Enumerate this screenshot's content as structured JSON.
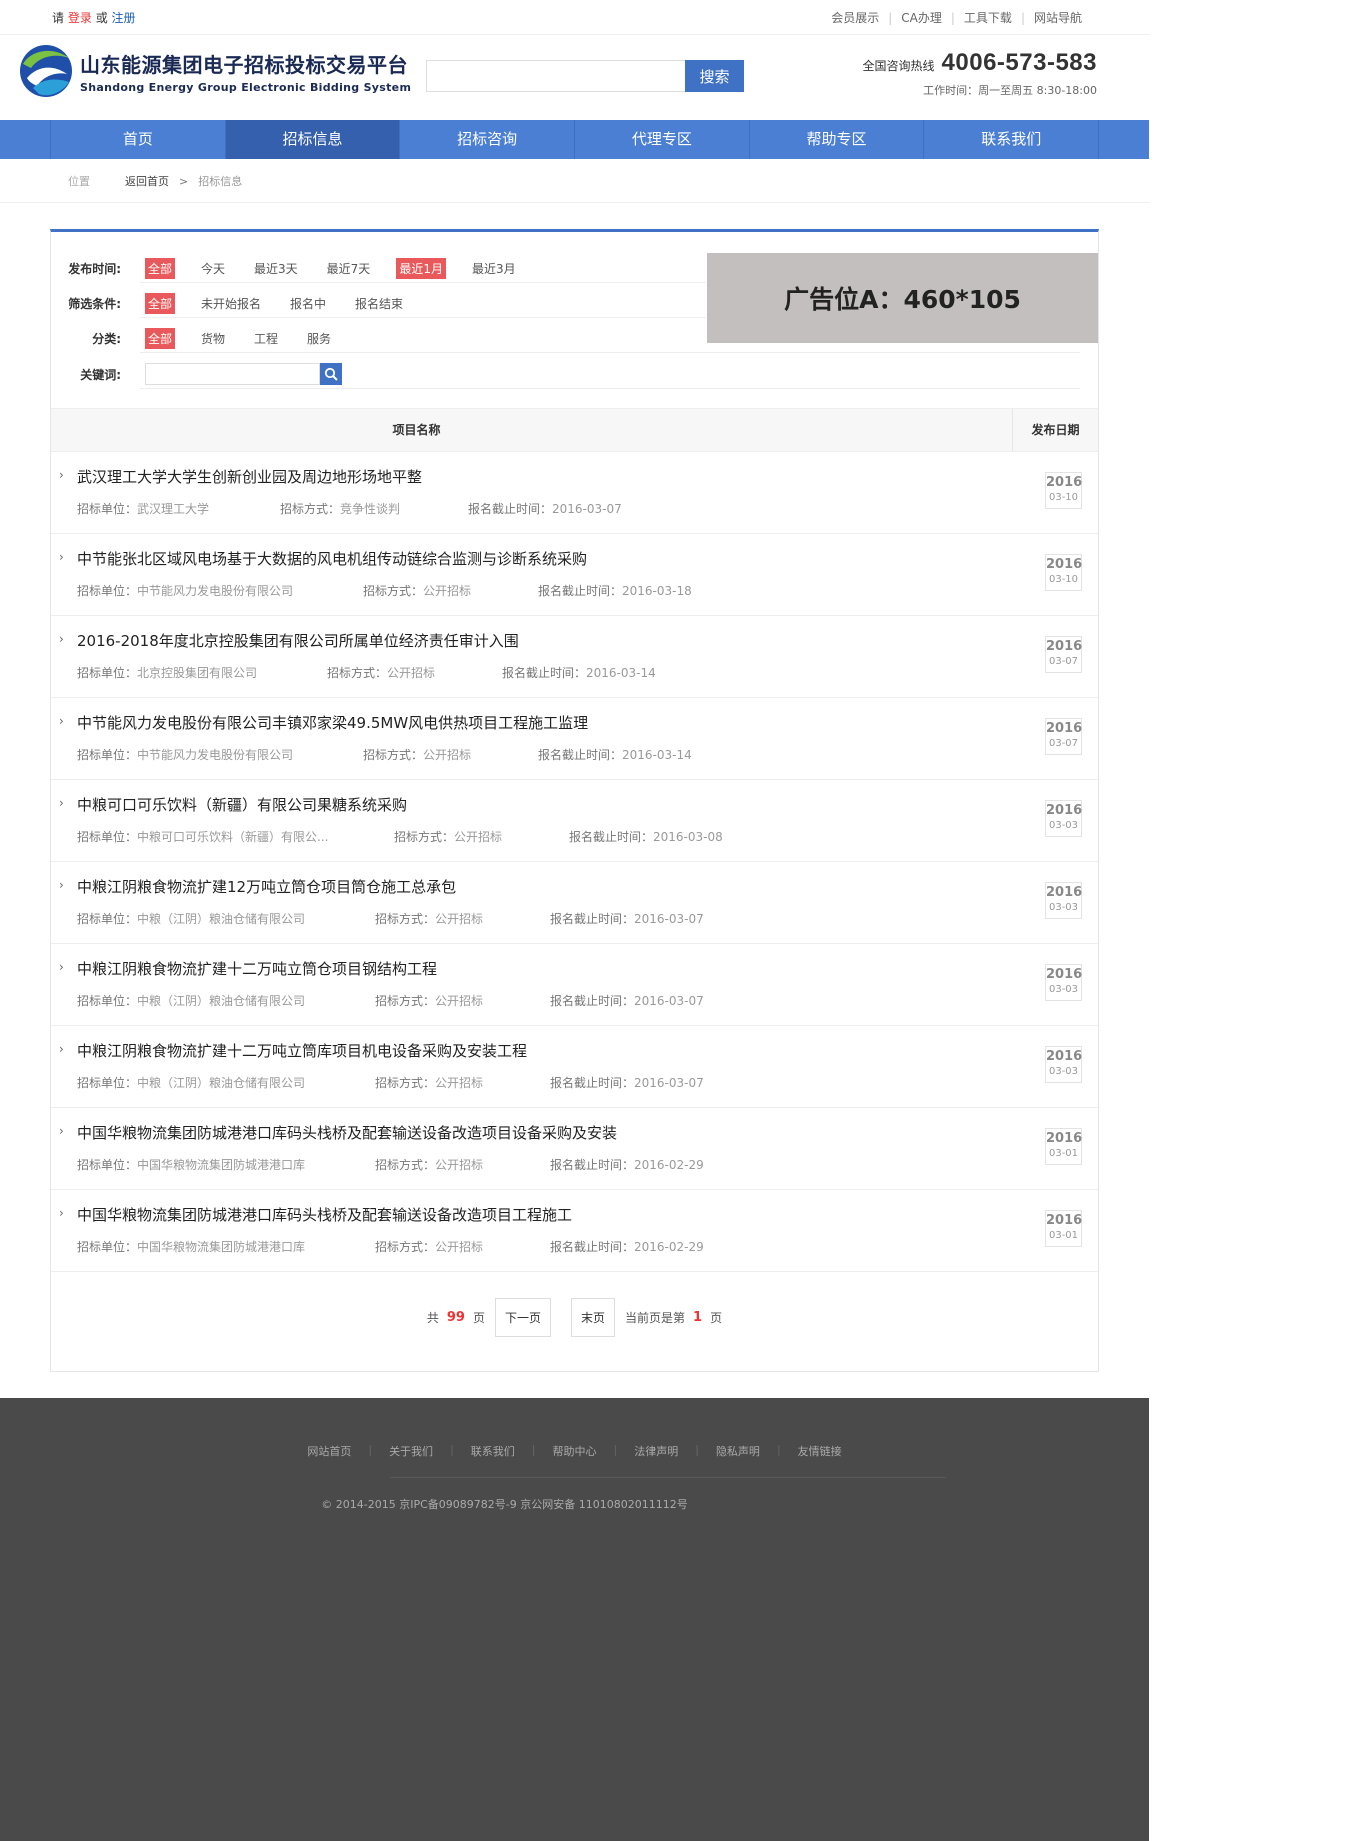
{
  "topbar": {
    "please": "请",
    "login": "登录",
    "or": "或",
    "register": "注册",
    "links": [
      "会员展示",
      "CA办理",
      "工具下载",
      "网站导航"
    ]
  },
  "header": {
    "title_cn": "山东能源集团电子招标投标交易平台",
    "title_en": "Shandong Energy Group Electronic Bidding System",
    "search_placeholder": "",
    "search_button": "搜索",
    "hotline_label": "全国咨询热线",
    "hotline_number": "4006-573-583",
    "work_time": "工作时间：周一至周五 8:30-18:00"
  },
  "nav": {
    "items": [
      "首页",
      "招标信息",
      "招标咨询",
      "代理专区",
      "帮助专区",
      "联系我们"
    ],
    "active_index": 1
  },
  "breadcrumb": {
    "position": "位置",
    "home": "返回首页",
    "arrow": ">",
    "current": "招标信息"
  },
  "filters": {
    "time": {
      "label": "发布时间:",
      "options": [
        "全部",
        "今天",
        "最近3天",
        "最近7天",
        "最近1月",
        "最近3月"
      ],
      "selected": [
        0,
        4
      ]
    },
    "condition": {
      "label": "筛选条件:",
      "options": [
        "全部",
        "未开始报名",
        "报名中",
        "报名结束"
      ],
      "selected": [
        0
      ]
    },
    "category": {
      "label": "分类:",
      "options": [
        "全部",
        "货物",
        "工程",
        "服务"
      ],
      "selected": [
        0
      ]
    },
    "keyword": {
      "label": "关键词:",
      "value": ""
    }
  },
  "ad": {
    "text": "广告位A：460*105"
  },
  "table": {
    "col_name": "项目名称",
    "col_date": "发布日期",
    "label_unit": "招标单位：",
    "label_method": "招标方式：",
    "label_deadline": "报名截止时间：",
    "rows": [
      {
        "title": "武汉理工大学大学生创新创业园及周边地形场地平整",
        "unit": "武汉理工大学",
        "method": "竞争性谈判",
        "deadline": "2016-03-07",
        "year": "2016",
        "md": "03-10"
      },
      {
        "title": "中节能张北区域风电场基于大数据的风电机组传动链综合监测与诊断系统采购",
        "unit": "中节能风力发电股份有限公司",
        "method": "公开招标",
        "deadline": "2016-03-18",
        "year": "2016",
        "md": "03-10"
      },
      {
        "title": "2016-2018年度北京控股集团有限公司所属单位经济责任审计入围",
        "unit": "北京控股集团有限公司",
        "method": "公开招标",
        "deadline": "2016-03-14",
        "year": "2016",
        "md": "03-07"
      },
      {
        "title": "中节能风力发电股份有限公司丰镇邓家梁49.5MW风电供热项目工程施工监理",
        "unit": "中节能风力发电股份有限公司",
        "method": "公开招标",
        "deadline": "2016-03-14",
        "year": "2016",
        "md": "03-07"
      },
      {
        "title": "中粮可口可乐饮料（新疆）有限公司果糖系统采购",
        "unit": "中粮可口可乐饮料（新疆）有限公...",
        "method": "公开招标",
        "deadline": "2016-03-08",
        "year": "2016",
        "md": "03-03"
      },
      {
        "title": "中粮江阴粮食物流扩建12万吨立筒仓项目筒仓施工总承包",
        "unit": "中粮（江阴）粮油仓储有限公司",
        "method": "公开招标",
        "deadline": "2016-03-07",
        "year": "2016",
        "md": "03-03"
      },
      {
        "title": "中粮江阴粮食物流扩建十二万吨立筒仓项目钢结构工程",
        "unit": "中粮（江阴）粮油仓储有限公司",
        "method": "公开招标",
        "deadline": "2016-03-07",
        "year": "2016",
        "md": "03-03"
      },
      {
        "title": "中粮江阴粮食物流扩建十二万吨立筒库项目机电设备采购及安装工程",
        "unit": "中粮（江阴）粮油仓储有限公司",
        "method": "公开招标",
        "deadline": "2016-03-07",
        "year": "2016",
        "md": "03-03"
      },
      {
        "title": "中国华粮物流集团防城港港口库码头栈桥及配套输送设备改造项目设备采购及安装",
        "unit": "中国华粮物流集团防城港港口库",
        "method": "公开招标",
        "deadline": "2016-02-29",
        "year": "2016",
        "md": "03-01"
      },
      {
        "title": "中国华粮物流集团防城港港口库码头栈桥及配套输送设备改造项目工程施工",
        "unit": "中国华粮物流集团防城港港口库",
        "method": "公开招标",
        "deadline": "2016-02-29",
        "year": "2016",
        "md": "03-01"
      }
    ]
  },
  "pager": {
    "total_prefix": "共",
    "total_pages": "99",
    "page_unit": "页",
    "next": "下一页",
    "last": "末页",
    "current_prefix": "当前页是第",
    "current_page": "1",
    "current_suffix": "页"
  },
  "footer": {
    "links": [
      "网站首页",
      "关于我们",
      "联系我们",
      "帮助中心",
      "法律声明",
      "隐私声明",
      "友情链接"
    ],
    "copyright": "© 2014-2015 京IPC备09089782号-9 京公网安备 11010802011112号"
  },
  "colors": {
    "brand_blue": "#4a7fd4",
    "accent_red": "#e9595b",
    "footer_bg": "#4a4a4a"
  }
}
